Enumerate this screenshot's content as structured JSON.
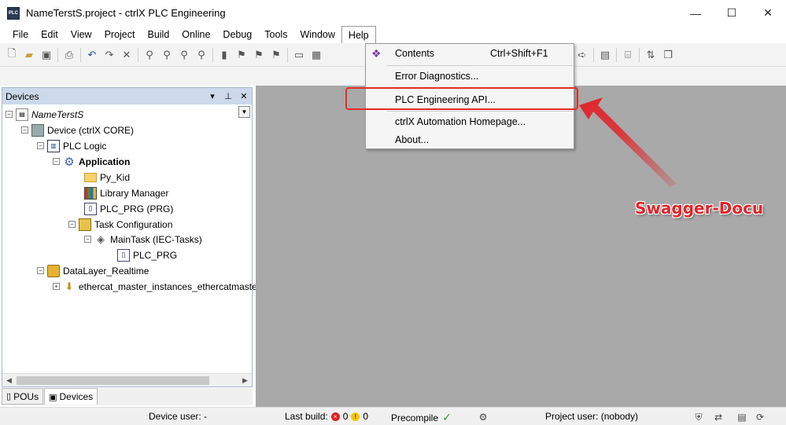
{
  "window": {
    "title": "NameTerstS.project - ctrlX PLC Engineering",
    "app_icon_text": "PLC",
    "minimize": "—",
    "maximize": "☐",
    "close": "✕"
  },
  "menubar": {
    "items": [
      "File",
      "Edit",
      "View",
      "Project",
      "Build",
      "Online",
      "Debug",
      "Tools",
      "Window",
      "Help"
    ],
    "active": "Help"
  },
  "help_menu": {
    "items": [
      {
        "label": "Contents",
        "shortcut": "Ctrl+Shift+F1",
        "icon": "book-icon"
      },
      {
        "label": "Error Diagnostics...",
        "shortcut": ""
      },
      {
        "label": "PLC Engineering API...",
        "shortcut": "",
        "highlighted": true
      },
      {
        "label": "ctrlX Automation Homepage...",
        "shortcut": ""
      },
      {
        "label": "About...",
        "shortcut": ""
      }
    ]
  },
  "devices_panel": {
    "title": "Devices",
    "pin": "⊥",
    "close": "✕",
    "dropdown": "▾",
    "tree": [
      {
        "label": "NameTerstS",
        "icon": "project-icon"
      },
      {
        "label": "Device (ctrlX CORE)",
        "icon": "device-icon"
      },
      {
        "label": "PLC Logic",
        "icon": "plc-logic-icon"
      },
      {
        "label": "Application",
        "icon": "application-icon"
      },
      {
        "label": "Py_Kid",
        "icon": "folder-icon"
      },
      {
        "label": "Library Manager",
        "icon": "library-icon"
      },
      {
        "label": "PLC_PRG (PRG)",
        "icon": "pou-icon"
      },
      {
        "label": "Task Configuration",
        "icon": "task-config-icon"
      },
      {
        "label": "MainTask (IEC-Tasks)",
        "icon": "task-icon"
      },
      {
        "label": "PLC_PRG",
        "icon": "pou-call-icon"
      },
      {
        "label": "DataLayer_Realtime",
        "icon": "datalayer-icon"
      },
      {
        "label": "ethercat_master_instances_ethercatmaste",
        "icon": "arrow-down-icon"
      }
    ]
  },
  "bottom_tabs": {
    "items": [
      {
        "label": "POUs",
        "active": false
      },
      {
        "label": "Devices",
        "active": true
      }
    ]
  },
  "statusbar": {
    "device_user": "Device user: -",
    "last_build_label": "Last build:",
    "errors": "0",
    "warnings": "0",
    "precompile": "Precompile",
    "project_user": "Project user: (nobody)"
  },
  "annotation": {
    "text": "Swagger-Docu",
    "color": "#e0252a"
  },
  "colors": {
    "workspace": "#a9a9a9",
    "panel_header": "#ccd9ea",
    "highlight": "#e52b2b"
  }
}
